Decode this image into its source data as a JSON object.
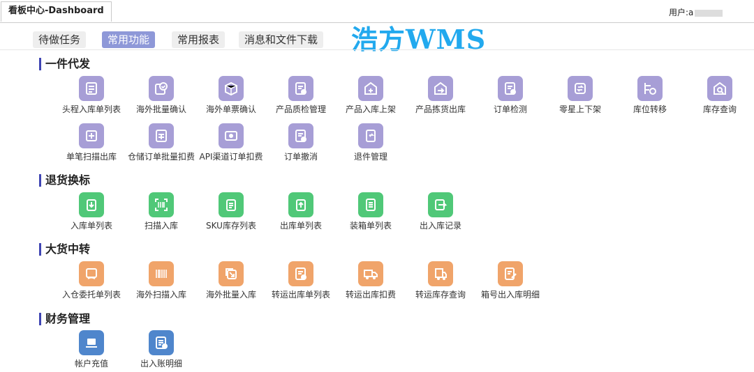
{
  "window": {
    "tab_title": "看板中心-Dashboard",
    "user_label": "用户:a"
  },
  "nav": {
    "tabs": [
      "待做任务",
      "常用功能",
      "常用报表",
      "消息和文件下载"
    ],
    "active_tab": "常用功能",
    "brand": "浩方WMS"
  },
  "sections": [
    {
      "title": "一件代发",
      "items": [
        "头程入库单列表",
        "海外批量确认",
        "海外单票确认",
        "产品质检管理",
        "产品入库上架",
        "产品拣货出库",
        "订单检测",
        "零星上下架",
        "库位转移",
        "库存查询",
        "单笔扫描出库",
        "仓储订单批量扣费",
        "API渠道订单扣费",
        "订单撤消",
        "退件管理"
      ]
    },
    {
      "title": "退货换标",
      "items": [
        "入库单列表",
        "扫描入库",
        "SKU库存列表",
        "出库单列表",
        "装箱单列表",
        "出入库记录"
      ]
    },
    {
      "title": "大货中转",
      "items": [
        "入仓委托单列表",
        "海外扫描入库",
        "海外批量入库",
        "转运出库单列表",
        "转运出库扣费",
        "转运库存查询",
        "箱号出入库明细"
      ]
    },
    {
      "title": "财务管理",
      "items": [
        "帐户充值",
        "出入账明细"
      ]
    }
  ],
  "colors": {
    "accent_nav": "#8e98d8",
    "brand": "#22a9ee",
    "icon_purple": "#a79ed6",
    "icon_green": "#50c878",
    "icon_orange": "#f0a46a",
    "icon_blue": "#4f86cc"
  }
}
